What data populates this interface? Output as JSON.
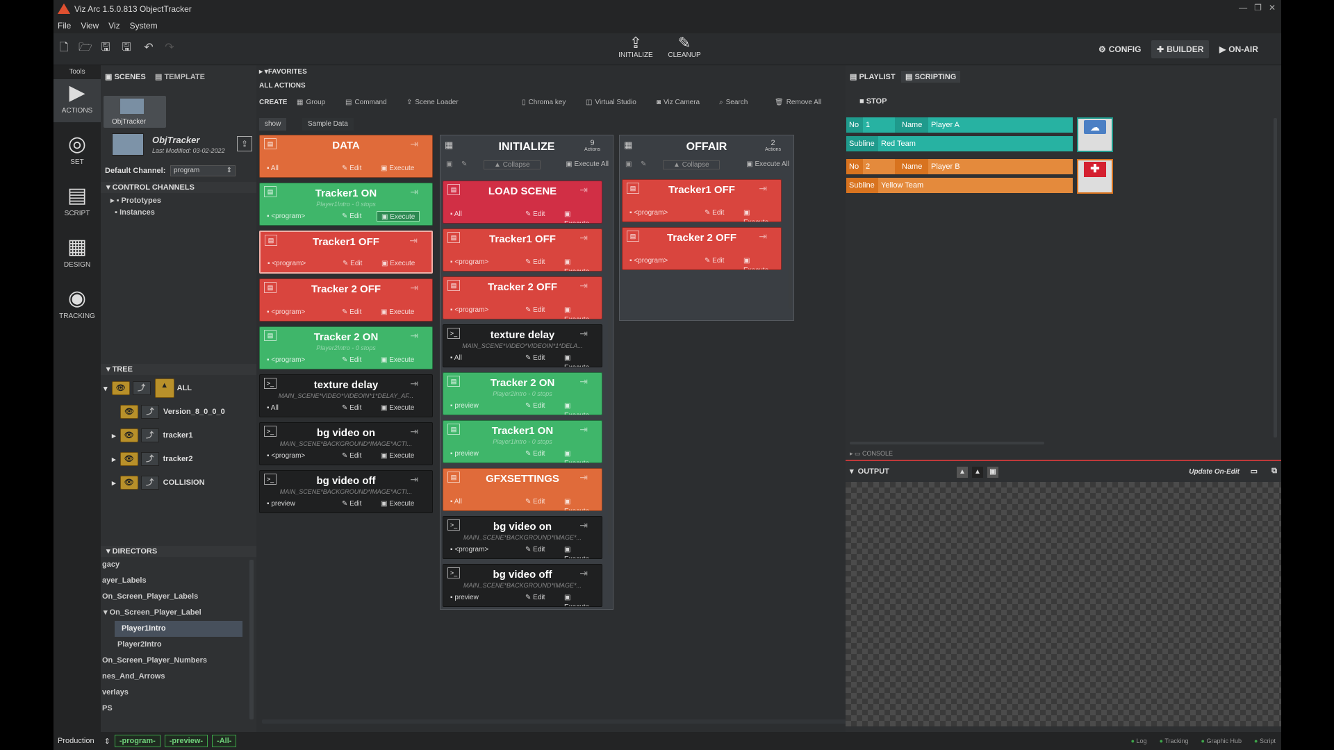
{
  "window": {
    "title": "Viz Arc 1.5.0.813 ObjectTracker",
    "controls": [
      "—",
      "❐",
      "✕"
    ]
  },
  "menu": [
    "File",
    "View",
    "Viz",
    "System"
  ],
  "toolbar": {
    "initialize": "INITIALIZE",
    "cleanup": "CLEANUP",
    "config": "CONFIG",
    "builder": "BUILDER",
    "on_air": "ON-AIR"
  },
  "tools": {
    "header": "Tools",
    "items": [
      "ACTIONS",
      "SET",
      "SCRIPT",
      "DESIGN",
      "TRACKING"
    ]
  },
  "left": {
    "tabs": [
      "SCENES",
      "TEMPLATE"
    ],
    "scene_thumb_label": "ObjTracker",
    "scene_name": "ObjTracker",
    "scene_modified": "Last Modified: 03-02-2022",
    "default_channel_label": "Default Channel:",
    "default_channel_value": "program",
    "control_channels": "CONTROL CHANNELS",
    "cc_items": [
      "Prototypes",
      "Instances"
    ],
    "tree": "TREE",
    "tree_items": [
      "ALL",
      "Version_8_0_0_0",
      "tracker1",
      "tracker2",
      "COLLISION"
    ],
    "directors": "DIRECTORS",
    "director_items": [
      "gacy",
      "ayer_Labels",
      "On_Screen_Player_Labels",
      "On_Screen_Player_Label",
      "Player1Intro",
      "Player2Intro",
      "On_Screen_Player_Numbers",
      "nes_And_Arrows",
      "verlays",
      "PS"
    ]
  },
  "actions": {
    "favorites": "FAVORITES",
    "all_actions": "ALL ACTIONS",
    "toolbar": [
      "CREATE",
      "Group",
      "Command",
      "Scene Loader",
      "Chroma key",
      "Virtual Studio",
      "Viz Camera",
      "Search",
      "Remove All"
    ],
    "tabs": [
      "show",
      "Sample Data"
    ],
    "edit": "Edit",
    "execute": "Execute",
    "collapse": "Collapse",
    "execute_all": "Execute All",
    "actions_word": "Actions",
    "col1": [
      {
        "title": "DATA",
        "channel": "All",
        "sub": ""
      },
      {
        "title": "Tracker1 ON",
        "channel": "<program>",
        "sub": "Player1Intro - 0 stops"
      },
      {
        "title": "Tracker1 OFF",
        "channel": "<program>",
        "sub": ""
      },
      {
        "title": "Tracker 2 OFF",
        "channel": "<program>",
        "sub": ""
      },
      {
        "title": "Tracker 2 ON",
        "channel": "<program>",
        "sub": "Player2Intro - 0 stops"
      },
      {
        "title": "texture delay",
        "channel": "All",
        "sub": "MAIN_SCENE*VIDEO*VIDEOIN*1*DELAY_AF..."
      },
      {
        "title": "bg video on",
        "channel": "<program>",
        "sub": "MAIN_SCENE*BACKGROUND*IMAGE*ACTI..."
      },
      {
        "title": "bg video off",
        "channel": "preview",
        "sub": "MAIN_SCENE*BACKGROUND*IMAGE*ACTI..."
      }
    ],
    "initialize": {
      "title": "INITIALIZE",
      "count": "9",
      "cards": [
        {
          "title": "LOAD SCENE",
          "channel": "All",
          "sub": ""
        },
        {
          "title": "Tracker1 OFF",
          "channel": "<program>",
          "sub": ""
        },
        {
          "title": "Tracker 2 OFF",
          "channel": "<program>",
          "sub": ""
        },
        {
          "title": "texture delay",
          "channel": "All",
          "sub": "MAIN_SCENE*VIDEO*VIDEOIN*1*DELA..."
        },
        {
          "title": "Tracker 2 ON",
          "channel": "preview",
          "sub": "Player2Intro - 0 stops"
        },
        {
          "title": "Tracker1 ON",
          "channel": "preview",
          "sub": "Player1Intro - 0 stops"
        },
        {
          "title": "GFXSETTINGS",
          "channel": "All",
          "sub": ""
        },
        {
          "title": "bg video on",
          "channel": "<program>",
          "sub": "MAIN_SCENE*BACKGROUND*IMAGE*..."
        },
        {
          "title": "bg video off",
          "channel": "preview",
          "sub": "MAIN_SCENE*BACKGROUND*IMAGE*..."
        }
      ]
    },
    "offair": {
      "title": "OFFAIR",
      "count": "2",
      "cards": [
        {
          "title": "Tracker1 OFF",
          "channel": "<program>",
          "sub": ""
        },
        {
          "title": "Tracker 2 OFF",
          "channel": "<program>",
          "sub": ""
        }
      ]
    }
  },
  "right": {
    "tabs": [
      "PLAYLIST",
      "SCRIPTING"
    ],
    "stop": "STOP",
    "players": [
      {
        "no_label": "No",
        "no": "1",
        "name_label": "Name",
        "name": "Player A",
        "sub_label": "Subline",
        "sub": "Red Team"
      },
      {
        "no_label": "No",
        "no": "2",
        "name_label": "Name",
        "name": "Player B",
        "sub_label": "Subline",
        "sub": "Yellow Team"
      }
    ],
    "console": "CONSOLE",
    "output": "OUTPUT",
    "update": "Update On-Edit"
  },
  "status": {
    "profile": "Production",
    "chips": [
      "-program-",
      "-preview-",
      "-All-"
    ],
    "right": [
      "Log",
      "Tracking",
      "Graphic Hub",
      "Script"
    ]
  },
  "colors": {
    "red": "#d9453e",
    "green": "#3fb66a",
    "black": "#1f2021",
    "orange": "#e06b3a",
    "crimson": "#d12f45",
    "teal": "#1f9a8c",
    "amber": "#d8731f"
  }
}
